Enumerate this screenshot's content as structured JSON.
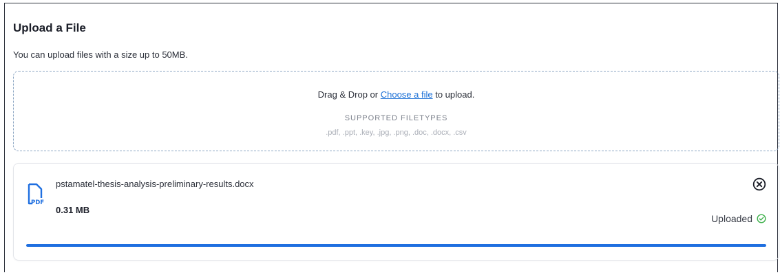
{
  "header": {
    "title": "Upload a File",
    "subtitle": "You can upload files with a size up to 50MB."
  },
  "dropzone": {
    "prefix": "Drag & Drop or ",
    "link_label": "Choose a file",
    "suffix": " to upload.",
    "filetypes_heading": "SUPPORTED FILETYPES",
    "filetypes_list": ".pdf, .ppt, .key, .jpg, .png, .doc, .docx, .csv"
  },
  "file": {
    "icon": "pdf-file-icon",
    "icon_label": "PDF",
    "name": "pstamatel-thesis-analysis-preliminary-results.docx",
    "size": "0.31 MB",
    "status": "Uploaded",
    "progress": 1.0,
    "remove_icon": "close-circle-icon",
    "status_icon": "check-circle-icon"
  },
  "colors": {
    "accent": "#1f6fe0",
    "link": "#1a6fd6",
    "success": "#3cb04a",
    "dropzone_border": "#8aa4c2"
  }
}
